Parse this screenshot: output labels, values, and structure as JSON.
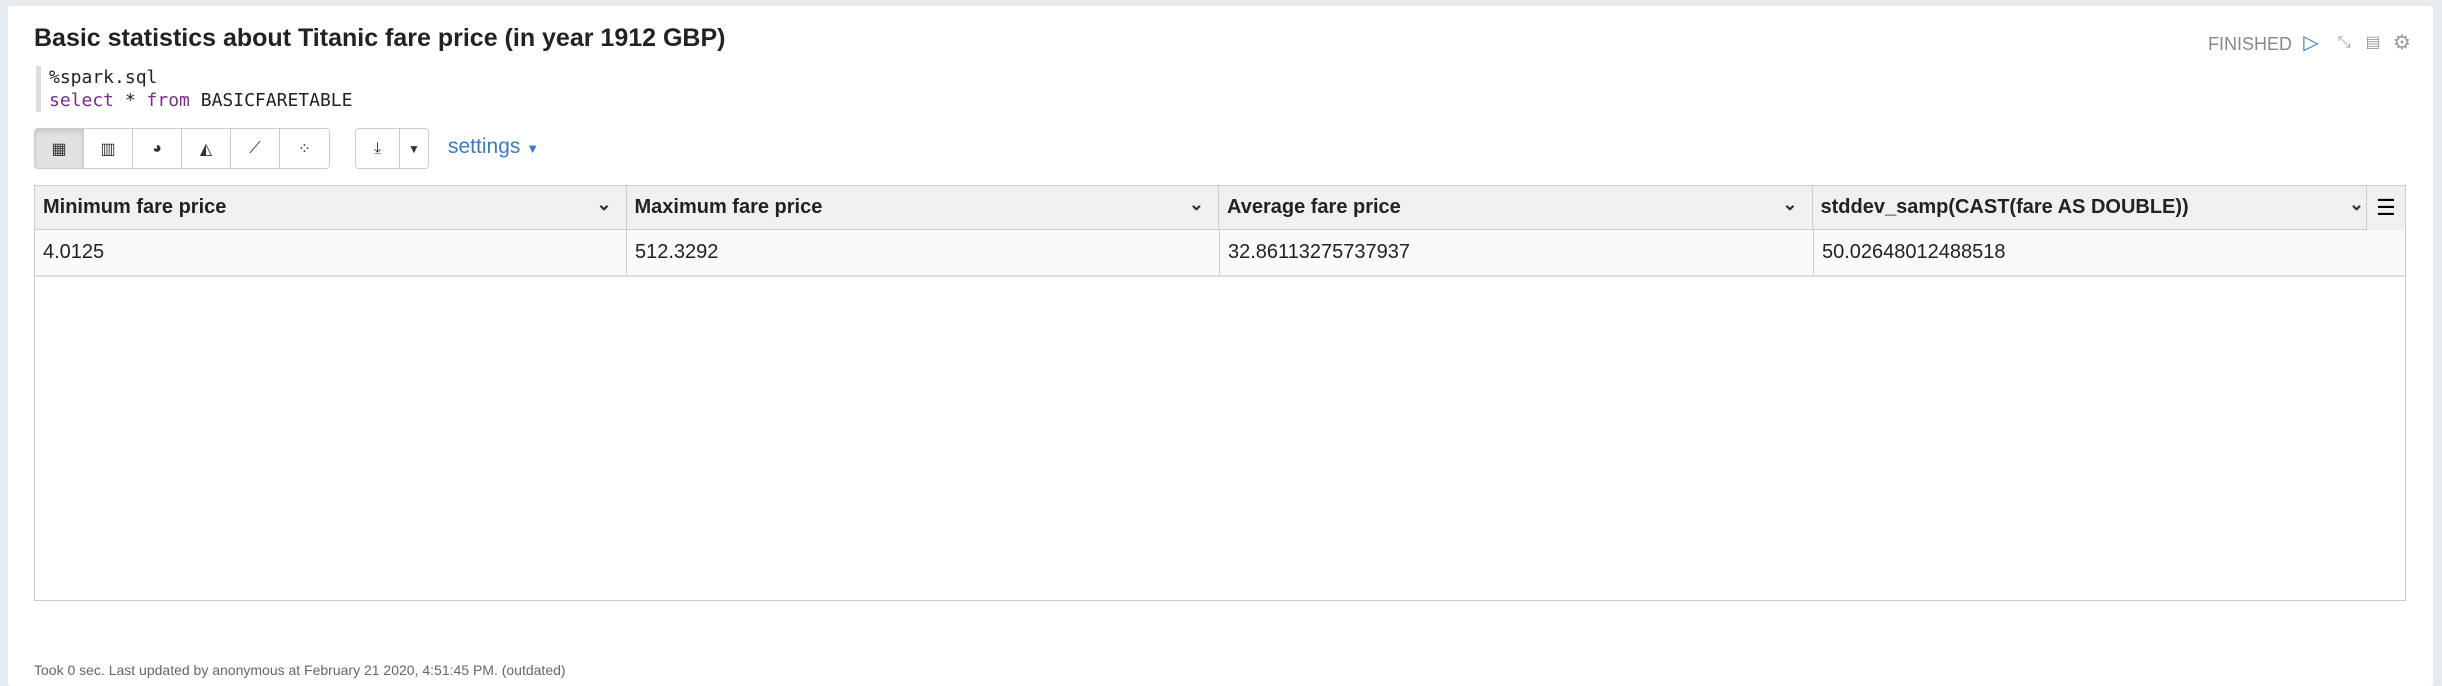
{
  "paragraph": {
    "title": "Basic statistics about Titanic fare price (in year 1912 GBP)",
    "status": "FINISHED",
    "code": {
      "line1": "%spark.sql",
      "kw_select": "select",
      "star": " * ",
      "kw_from": "from",
      "table": " BASICFARETABLE"
    }
  },
  "toolbar": {
    "settings_label": "settings"
  },
  "table": {
    "columns": [
      "Minimum fare price",
      "Maximum fare price",
      "Average fare price",
      "stddev_samp(CAST(fare AS DOUBLE))"
    ],
    "rows": [
      [
        "4.0125",
        "512.3292",
        "32.86113275737937",
        "50.02648012488518"
      ]
    ]
  },
  "footer": "Took 0 sec. Last updated by anonymous at February 21 2020, 4:51:45 PM. (outdated)",
  "colors": {
    "accent": "#3a7bc8",
    "keyword": "#7a2e8a"
  }
}
